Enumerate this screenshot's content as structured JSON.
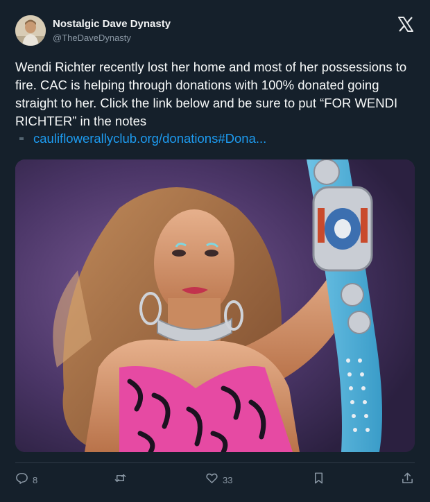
{
  "author": {
    "display_name": "Nostalgic Dave Dynasty",
    "handle": "@TheDaveDynasty"
  },
  "tweet": {
    "text": "Wendi Richter recently lost her home and most of her possessions to fire. CAC is helping through donations with 100% donated going straight to her. Click the link below and be sure to put “FOR WENDI RICHTER” in the notes",
    "link": "cauliflowerallyclub.org/donations#Dona..."
  },
  "actions": {
    "replies": "8",
    "likes": "33"
  },
  "colors": {
    "background": "#15202b",
    "link": "#1d9bf0",
    "muted": "#8b98a5"
  },
  "icons": [
    "x-logo-icon",
    "reply-icon",
    "retweet-icon",
    "like-icon",
    "bookmark-icon",
    "share-icon"
  ]
}
